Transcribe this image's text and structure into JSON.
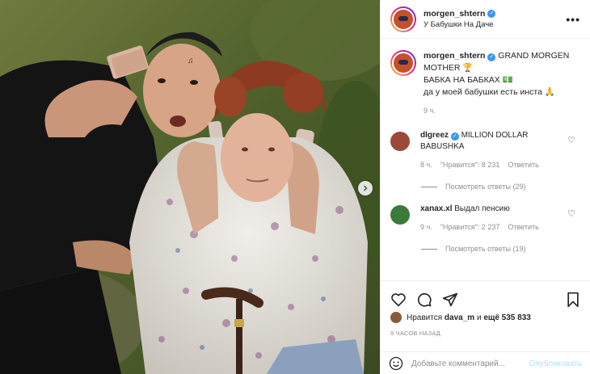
{
  "post": {
    "username": "morgen_shtern",
    "location": "У Бабушки На Даче",
    "more_label": "•••"
  },
  "caption": {
    "username": "morgen_shtern",
    "line1": "GRAND MORGEN MOTHER 🏆",
    "line2": "БАБКА НА БАБКАХ 💵",
    "line3": "да у моей бабушки есть инста 🙏",
    "time": "9 ч."
  },
  "comments": [
    {
      "username": "dlgreez",
      "text": "MILLION DOLLAR BABUSHKA",
      "time": "8 ч.",
      "likes": "\"Нравится\": 8 231",
      "reply_label": "Ответить",
      "view_replies": "Посмотреть ответы (29)"
    },
    {
      "username": "xanax.xl",
      "text": "Выдал пенсию",
      "time": "9 ч.",
      "likes": "\"Нравится\": 2 237",
      "reply_label": "Ответить",
      "view_replies": "Посмотреть ответы (19)"
    }
  ],
  "likes": {
    "prefix": "Нравится",
    "user": "dava_m",
    "middle": "и",
    "count": "ещё 535 833"
  },
  "posted_ago": "9 ЧАСОВ НАЗАД",
  "comment_box": {
    "placeholder": "Добавьте комментарий...",
    "publish_label": "Опубликовать"
  },
  "icons": {
    "heart": "heart-icon",
    "comment": "comment-icon",
    "share": "share-icon",
    "bookmark": "bookmark-icon",
    "emoji": "emoji-icon",
    "next": "chevron-right-icon"
  },
  "colors": {
    "verified": "#3897f0",
    "muted": "#8e8e8e",
    "publish_disabled": "#b2dffc",
    "text": "#262626"
  }
}
